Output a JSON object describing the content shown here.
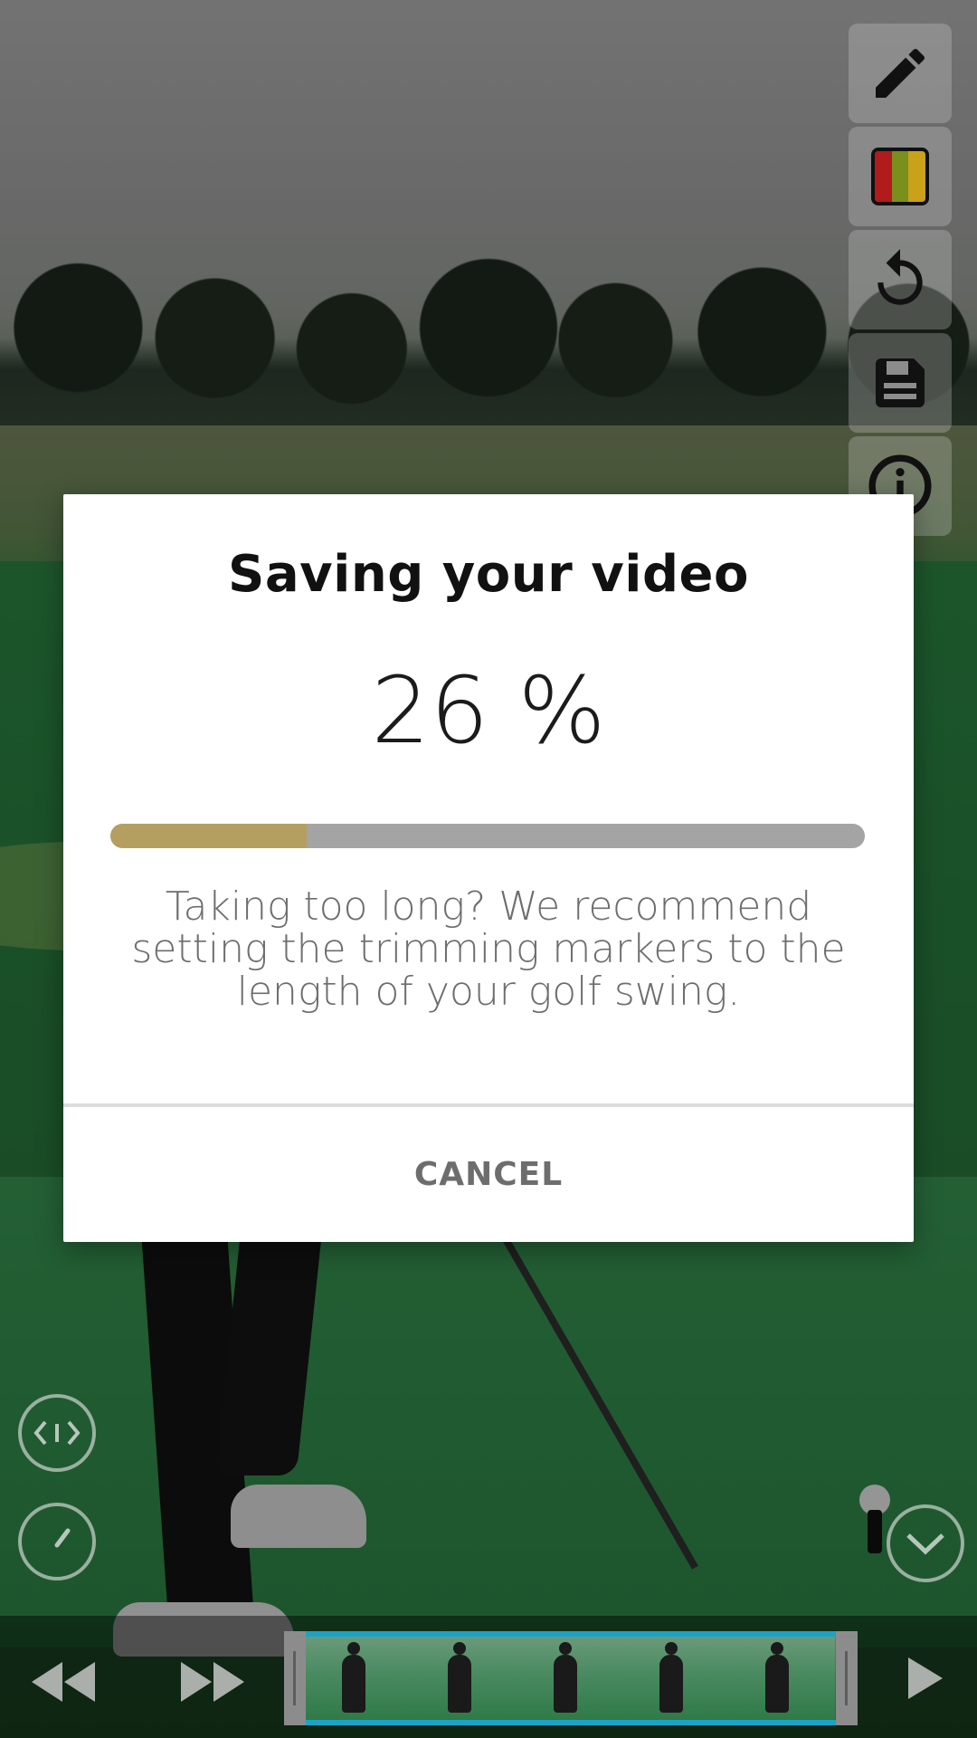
{
  "dialog": {
    "title": "Saving your video",
    "percent_text": "26 %",
    "progress": 0.26,
    "message": "Taking too long? We recommend setting the trimming markers to the length of your golf swing.",
    "cancel_label": "CANCEL"
  },
  "toolbar": {
    "tools": [
      "pencil-icon",
      "color-swatch-icon",
      "undo-icon",
      "save-icon",
      "info-icon"
    ]
  },
  "colors": {
    "progress_fill": "#b59f60",
    "progress_track": "#a4a4a4",
    "strip_border": "#1aa3c9",
    "swatch": [
      "#b11b1b",
      "#7a8f1c",
      "#c9a21a"
    ]
  }
}
